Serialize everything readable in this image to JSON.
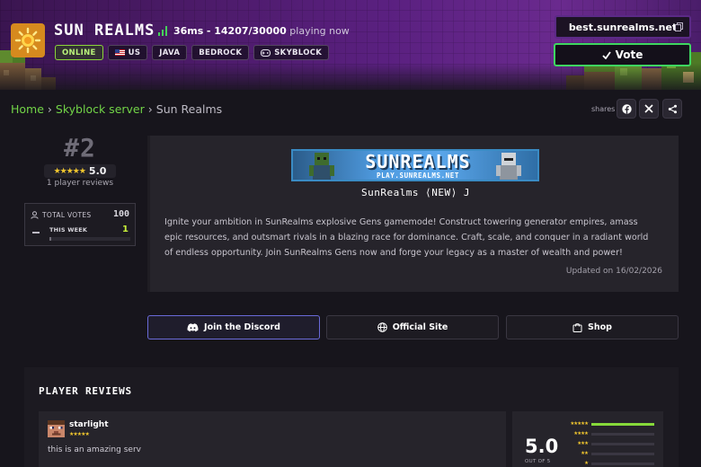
{
  "hero": {
    "server_name": "SUN REALMS",
    "ping": "36ms",
    "players": "14207/30000",
    "players_suffix": "playing now",
    "tags": {
      "online": "ONLINE",
      "country": "US",
      "java": "JAVA",
      "bedrock": "BEDROCK",
      "skyblock": "SKYBLOCK"
    },
    "address": "best.sunrealms.net",
    "vote_label": "Vote",
    "colors": {
      "online_green": "#8bd43a",
      "vote_green": "#3ed660",
      "hero_purple": "#5a2080"
    }
  },
  "breadcrumb": {
    "home": "Home",
    "category": "Skyblock server",
    "current": "Sun Realms",
    "separator": "›"
  },
  "share": {
    "label": "shares",
    "icons": [
      "facebook-icon",
      "x-icon",
      "share-icon"
    ]
  },
  "ranking": {
    "rank": "#2",
    "rating": "5.0",
    "stars": "★★★★★",
    "review_count": "1 player reviews"
  },
  "votes": {
    "total_label": "TOTAL VOTES",
    "total_value": "100",
    "week_label": "THIS WEEK",
    "week_value": "1",
    "week_progress": 0.02
  },
  "info": {
    "banner_title": "SUNREALMS",
    "banner_sub": "PLAY.SUNREALMS.NET",
    "motd": "SunRealms ⟨NEW⟩ J",
    "description": "Ignite your ambition in SunRealms explosive Gens gamemode! Construct towering generator empires, amass epic resources, and outsmart rivals in a blazing race for dominance. Craft, scale, and conquer in a radiant world of endless opportunity. Join SunRealms Gens now and forge your legacy as a master of wealth and power!",
    "updated": "Updated on 16/02/2026"
  },
  "actions": {
    "discord": "Join the Discord",
    "site": "Official Site",
    "shop": "Shop"
  },
  "reviews": {
    "title": "PLAYER REVIEWS",
    "items": [
      {
        "name": "starlight",
        "stars": "★★★★★",
        "text": "this is an amazing serv"
      }
    ],
    "summary": {
      "score": "5.0",
      "out_of": "OUT OF 5",
      "distribution": [
        {
          "stars": "★★★★★",
          "fraction": 1.0
        },
        {
          "stars": "★★★★",
          "fraction": 0
        },
        {
          "stars": "★★★",
          "fraction": 0
        },
        {
          "stars": "★★",
          "fraction": 0
        },
        {
          "stars": "★",
          "fraction": 0
        }
      ]
    }
  }
}
